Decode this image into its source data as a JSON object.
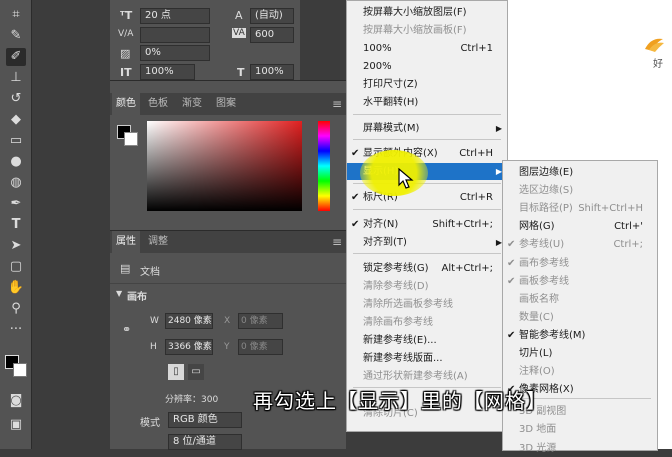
{
  "char_panel": {
    "font_size": "20 点",
    "leading": "(自动)",
    "kerning_label": "V/A",
    "tracking": "600",
    "scale_pct": "0%",
    "vscale": "100%",
    "hscale": "100%",
    "tt_icon": "T"
  },
  "color_panel": {
    "tabs": [
      "颜色",
      "色板",
      "渐变",
      "图案"
    ],
    "accent": "#e02020"
  },
  "props_panel": {
    "tabs": [
      "属性",
      "调整"
    ],
    "doc_label": "文档",
    "section": "画布",
    "w_label": "W",
    "w_value": "2480 像素",
    "h_label": "H",
    "h_value": "3366 像素",
    "x_label": "X",
    "x_value": "0 像素",
    "y_label": "Y",
    "y_value": "0 像素",
    "resolution": "分辨率：300",
    "mode_label": "模式",
    "mode_value": "RGB 颜色",
    "depth_value": "8 位/通道"
  },
  "view_menu": {
    "items": [
      {
        "label": "按屏幕大小缩放图层(F)",
        "shortcut": "",
        "disabled": false
      },
      {
        "label": "按屏幕大小缩放画板(F)",
        "shortcut": "",
        "disabled": true
      },
      {
        "label": "100%",
        "shortcut": "Ctrl+1",
        "disabled": false
      },
      {
        "label": "200%",
        "shortcut": "",
        "disabled": false
      },
      {
        "label": "打印尺寸(Z)",
        "shortcut": "",
        "disabled": false
      },
      {
        "label": "水平翻转(H)",
        "shortcut": "",
        "disabled": false
      },
      {
        "label": "屏幕模式(M)",
        "shortcut": "",
        "disabled": false
      },
      {
        "label": "显示额外内容(X)",
        "shortcut": "Ctrl+H",
        "disabled": false
      },
      {
        "label": "显示(H)",
        "shortcut": "",
        "disabled": false
      },
      {
        "label": "标尺(R)",
        "shortcut": "Ctrl+R",
        "disabled": false
      },
      {
        "label": "对齐(N)",
        "shortcut": "Shift+Ctrl+;",
        "disabled": false
      },
      {
        "label": "对齐到(T)",
        "shortcut": "",
        "disabled": false
      },
      {
        "label": "锁定参考线(G)",
        "shortcut": "Alt+Ctrl+;",
        "disabled": false
      },
      {
        "label": "清除参考线(D)",
        "shortcut": "",
        "disabled": true
      },
      {
        "label": "清除所选画板参考线",
        "shortcut": "",
        "disabled": true
      },
      {
        "label": "清除画布参考线",
        "shortcut": "",
        "disabled": true
      },
      {
        "label": "新建参考线(E)...",
        "shortcut": "",
        "disabled": false
      },
      {
        "label": "新建参考线版面...",
        "shortcut": "",
        "disabled": false
      },
      {
        "label": "通过形状新建参考线(A)",
        "shortcut": "",
        "disabled": true
      },
      {
        "label": "清除切片(C)",
        "shortcut": "",
        "disabled": true
      }
    ]
  },
  "show_submenu": {
    "items": [
      {
        "label": "图层边缘(E)",
        "shortcut": "",
        "disabled": false
      },
      {
        "label": "选区边缘(S)",
        "shortcut": "",
        "disabled": true
      },
      {
        "label": "目标路径(P)",
        "shortcut": "Shift+Ctrl+H",
        "disabled": true
      },
      {
        "label": "网格(G)",
        "shortcut": "Ctrl+'",
        "disabled": false
      },
      {
        "label": "参考线(U)",
        "shortcut": "Ctrl+;",
        "disabled": true
      },
      {
        "label": "画布参考线",
        "shortcut": "",
        "disabled": true
      },
      {
        "label": "画板参考线",
        "shortcut": "",
        "disabled": true
      },
      {
        "label": "画板名称",
        "shortcut": "",
        "disabled": true
      },
      {
        "label": "数量(C)",
        "shortcut": "",
        "disabled": true
      },
      {
        "label": "智能参考线(M)",
        "shortcut": "",
        "disabled": false
      },
      {
        "label": "切片(L)",
        "shortcut": "",
        "disabled": false
      },
      {
        "label": "注释(O)",
        "shortcut": "",
        "disabled": true
      },
      {
        "label": "像素网格(X)",
        "shortcut": "",
        "disabled": false
      },
      {
        "label": "3D 副视图",
        "shortcut": "",
        "disabled": true
      },
      {
        "label": "3D 地面",
        "shortcut": "",
        "disabled": true
      },
      {
        "label": "3D 光源",
        "shortcut": "",
        "disabled": true
      }
    ]
  },
  "corner_text": "好",
  "subtitle": "再勾选上【显示】里的【网格】"
}
